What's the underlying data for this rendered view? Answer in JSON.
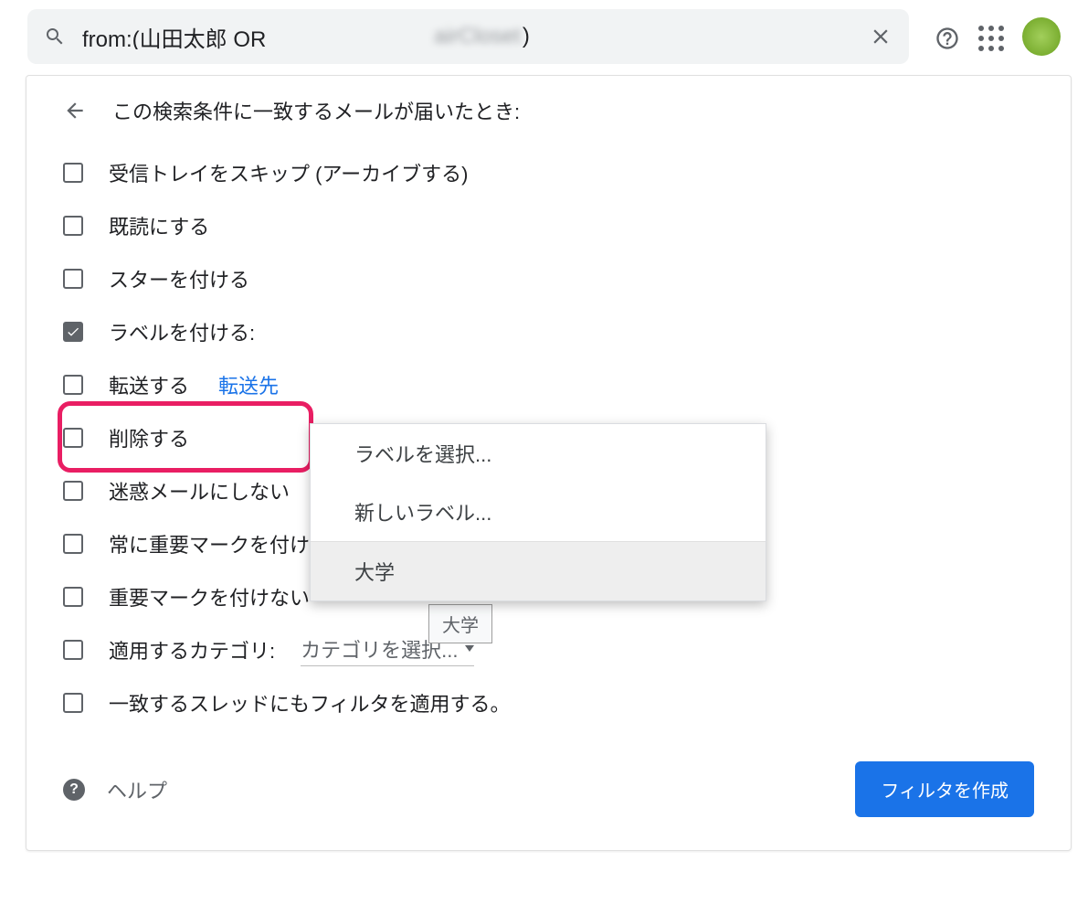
{
  "search": {
    "value_visible": "from:(山田太郎 OR",
    "value_tail": ")",
    "redacted_segment": "airCloset"
  },
  "panel": {
    "title": "この検索条件に一致するメールが届いたとき:",
    "help_label": "ヘルプ",
    "create_button": "フィルタを作成"
  },
  "options": [
    {
      "label": "受信トレイをスキップ (アーカイブする)",
      "checked": false
    },
    {
      "label": "既読にする",
      "checked": false
    },
    {
      "label": "スターを付ける",
      "checked": false
    },
    {
      "label": "ラベルを付ける:",
      "checked": true
    },
    {
      "label": "転送する",
      "checked": false,
      "link": "転送先"
    },
    {
      "label": "削除する",
      "checked": false
    },
    {
      "label": "迷惑メールにしない",
      "checked": false
    },
    {
      "label": "常に重要マークを付ける",
      "checked": false
    },
    {
      "label": "重要マークを付けない",
      "checked": false
    },
    {
      "label": "適用するカテゴリ:",
      "checked": false,
      "select": "カテゴリを選択..."
    },
    {
      "label": "一致するスレッドにもフィルタを適用する。",
      "checked": false
    }
  ],
  "label_dropdown": {
    "items": [
      "ラベルを選択...",
      "新しいラベル..."
    ],
    "existing_labels": [
      "大学"
    ],
    "hovered": "大学"
  },
  "tooltip": "大学"
}
